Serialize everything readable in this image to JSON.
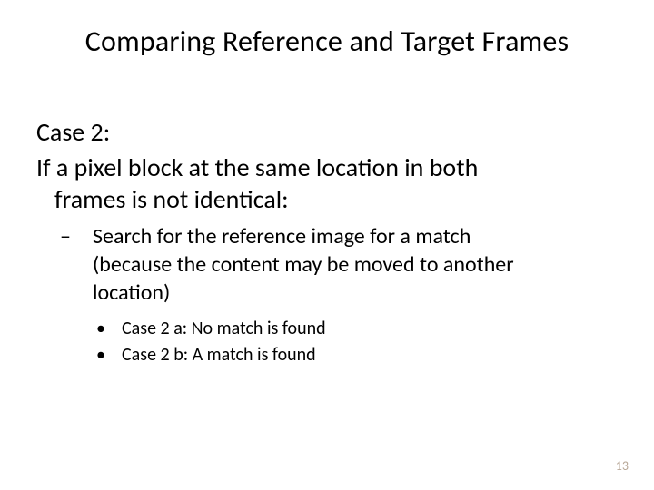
{
  "title": "Comparing Reference and Target Frames",
  "case_label": "Case 2:",
  "case_desc_line1": "If a pixel block at the same location in both",
  "case_desc_line2": "frames is not identical:",
  "sub1_line1": "Search for the reference image for a match",
  "sub1_line2": "(because the content may be moved to another",
  "sub1_line3": "location)",
  "sub2a": "Case 2 a: No match is found",
  "sub2b": "Case 2 b: A match is found",
  "page_number": "13",
  "glyphs": {
    "dash": "–",
    "bullet": "•"
  }
}
